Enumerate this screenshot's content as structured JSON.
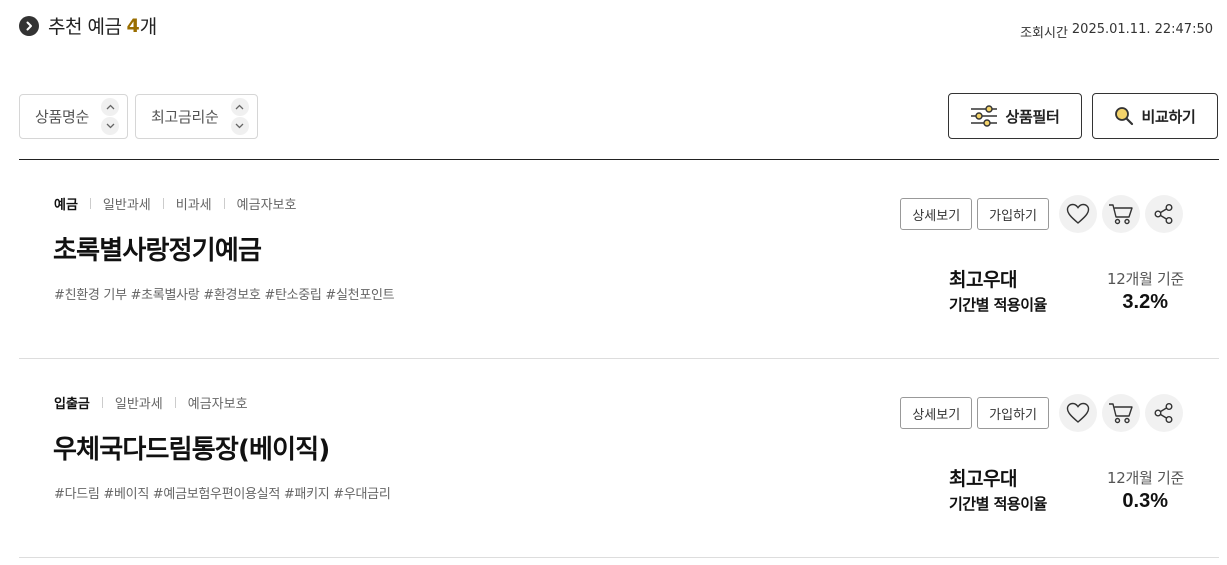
{
  "header": {
    "title": "추천 예금",
    "count": "4",
    "count_unit": "개",
    "inquiry_label": "조회시간",
    "inquiry_time": "2025.01.11. 22:47:50"
  },
  "sort": [
    {
      "label": "상품명순"
    },
    {
      "label": "최고금리순"
    }
  ],
  "actions": {
    "filter_label": "상품필터",
    "compare_label": "비교하기"
  },
  "products": [
    {
      "tag_main": "예금",
      "tags": [
        "일반과세",
        "비과세",
        "예금자보호"
      ],
      "name": "초록별사랑정기예금",
      "hashtags": "#친환경 기부 #초록별사랑 #환경보호 #탄소중립 #실천포인트",
      "detail_label": "상세보기",
      "join_label": "가입하기",
      "rate_title": "최고우대",
      "rate_subtitle": "기간별 적용이율",
      "rate_basis": "12개월 기준",
      "rate_value": "3.2%"
    },
    {
      "tag_main": "입출금",
      "tags": [
        "일반과세",
        "예금자보호"
      ],
      "name": "우체국다드림통장(베이직)",
      "hashtags": "#다드림 #베이직 #예금보험우편이용실적 #패키지 #우대금리",
      "detail_label": "상세보기",
      "join_label": "가입하기",
      "rate_title": "최고우대",
      "rate_subtitle": "기간별 적용이율",
      "rate_basis": "12개월 기준",
      "rate_value": "0.3%"
    }
  ],
  "icons": {
    "header": "chevron-right-circle-icon",
    "sort_up": "chevron-up-icon",
    "sort_down": "chevron-down-icon",
    "filter": "sliders-icon",
    "compare": "magnifier-icon",
    "like": "heart-icon",
    "cart": "cart-icon",
    "share": "share-icon"
  },
  "colors": {
    "accent": "#9a6e00",
    "text": "#222222",
    "border": "#d6d6d6"
  }
}
